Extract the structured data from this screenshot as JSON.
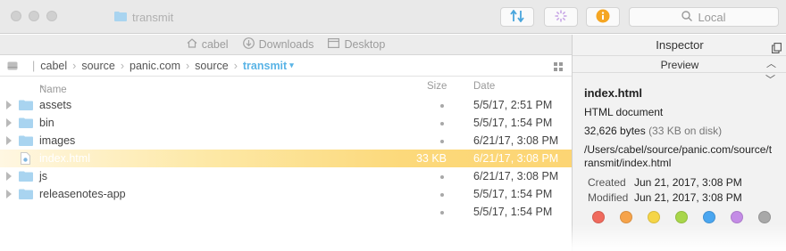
{
  "window": {
    "title": "transmit"
  },
  "toolbar": {
    "search_placeholder": "Local"
  },
  "favorites": [
    {
      "label": "cabel",
      "icon": "home-icon"
    },
    {
      "label": "Downloads",
      "icon": "download-icon"
    },
    {
      "label": "Desktop",
      "icon": "desktop-icon"
    }
  ],
  "breadcrumb": {
    "items": [
      "cabel",
      "source",
      "panic.com",
      "source"
    ],
    "current": "transmit"
  },
  "columns": {
    "name": "Name",
    "size": "Size",
    "date": "Date"
  },
  "files": [
    {
      "name": "assets",
      "kind": "folder",
      "size": "•",
      "date": "5/5/17, 2:51 PM"
    },
    {
      "name": "bin",
      "kind": "folder",
      "size": "•",
      "date": "5/5/17, 1:54 PM"
    },
    {
      "name": "images",
      "kind": "folder",
      "size": "•",
      "date": "6/21/17, 3:08 PM"
    },
    {
      "name": "index.html",
      "kind": "file",
      "size": "33 KB",
      "date": "6/21/17, 3:08 PM",
      "selected": true
    },
    {
      "name": "js",
      "kind": "folder",
      "size": "•",
      "date": "6/21/17, 3:08 PM"
    },
    {
      "name": "releasenotes-app",
      "kind": "folder",
      "size": "•",
      "date": "5/5/17, 1:54 PM"
    },
    {
      "name": "",
      "kind": "folder",
      "size": "•",
      "date": "5/5/17, 1:54 PM"
    }
  ],
  "inspector": {
    "title": "Inspector",
    "preview_label": "Preview",
    "file_name": "index.html",
    "kind": "HTML document",
    "bytes": "32,626 bytes",
    "on_disk": "(33 KB on disk)",
    "path": "/Users/cabel/source/panic.com/source/transmit/index.html",
    "created_label": "Created",
    "created": "Jun 21, 2017, 3:08 PM",
    "modified_label": "Modified",
    "modified": "Jun 21, 2017, 3:08 PM",
    "labels": [
      "#f06a5d",
      "#f6a34a",
      "#f5d547",
      "#a8d64a",
      "#4aa6f0",
      "#c48ce6",
      "#a8a8a8"
    ]
  }
}
